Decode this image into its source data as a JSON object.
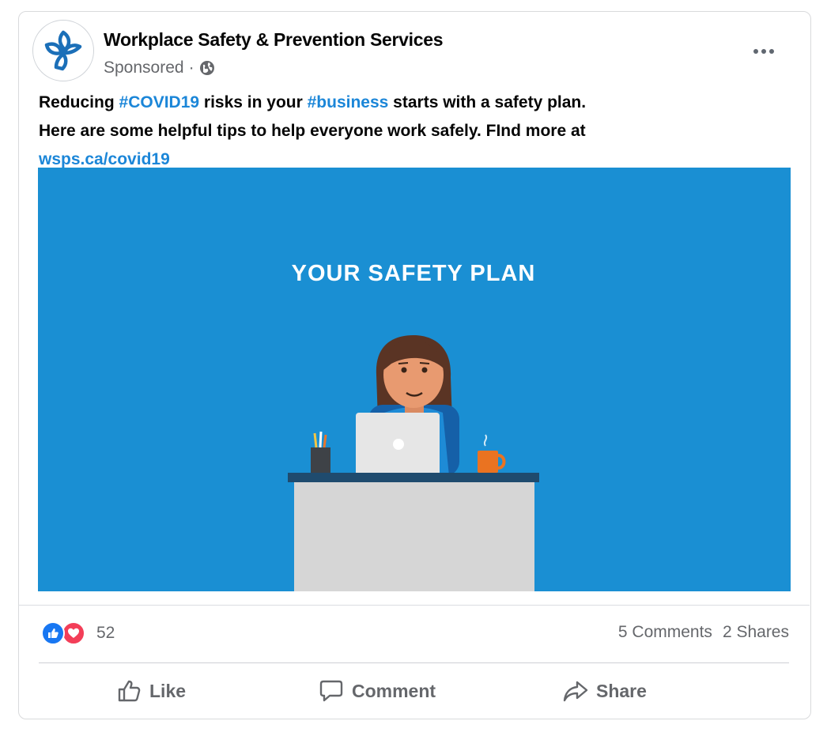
{
  "post": {
    "page_name": "Workplace Safety & Prevention Services",
    "sponsored_label": "Sponsored",
    "separator": "·",
    "audience_icon": "globe-icon",
    "more_icon": "more-options-icon",
    "text": {
      "line1": {
        "a": "Reducing ",
        "hashtag1": "#COVID19",
        "b": " risks in your ",
        "hashtag2": "#business",
        "c": " starts with a safety plan."
      },
      "line2": "Here are some helpful tips to help everyone work safely. FInd more at",
      "link": "wsps.ca/covid19"
    },
    "media": {
      "title": "YOUR SAFETY PLAN",
      "background_color": "#1a8fd3"
    }
  },
  "stats": {
    "reaction_icons": [
      "like-reaction-icon",
      "love-reaction-icon"
    ],
    "reaction_count": "52",
    "comments": "5 Comments",
    "shares": "2 Shares"
  },
  "actions": {
    "like": "Like",
    "comment": "Comment",
    "share": "Share"
  },
  "colors": {
    "link": "#1b86d8",
    "like_blue": "#1877f2",
    "love_red": "#f33e58",
    "secondary_text": "#65676b",
    "logo_blue": "#1b6fb8"
  }
}
